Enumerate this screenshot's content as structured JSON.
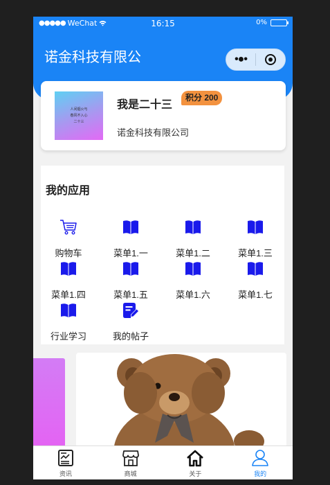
{
  "status_bar": {
    "carrier": "WeChat",
    "time": "16:15",
    "battery": "0%"
  },
  "header": {
    "title": "诺金科技有限公"
  },
  "profile": {
    "name": "我是二十三",
    "points_badge": "积分 200",
    "company": "诺金科技有限公司",
    "avatar_lines": [
      "人间烟火与",
      "春风不入心",
      "二十三"
    ]
  },
  "apps": {
    "title": "我的应用",
    "items": [
      {
        "label": "购物车",
        "icon": "shopping-cart-icon"
      },
      {
        "label": "菜单1.一",
        "icon": "book-icon"
      },
      {
        "label": "菜单1.二",
        "icon": "book-icon"
      },
      {
        "label": "菜单1.三",
        "icon": "book-icon"
      },
      {
        "label": "菜单1.四",
        "icon": "book-icon"
      },
      {
        "label": "菜单1.五",
        "icon": "book-icon"
      },
      {
        "label": "菜单1.六",
        "icon": "book-icon"
      },
      {
        "label": "菜单1.七",
        "icon": "book-icon"
      },
      {
        "label": "行业学习",
        "icon": "book-icon"
      },
      {
        "label": "我的帖子",
        "icon": "edit-document-icon"
      }
    ]
  },
  "tabbar": {
    "items": [
      {
        "label": "资讯",
        "icon": "news-icon"
      },
      {
        "label": "商城",
        "icon": "store-icon"
      },
      {
        "label": "关于",
        "icon": "home-icon"
      },
      {
        "label": "我的",
        "icon": "user-icon"
      }
    ],
    "active": "我的"
  },
  "colors": {
    "primary": "#1a84f6",
    "badge": "#f3923f",
    "app_icon": "#1a1aeb"
  }
}
